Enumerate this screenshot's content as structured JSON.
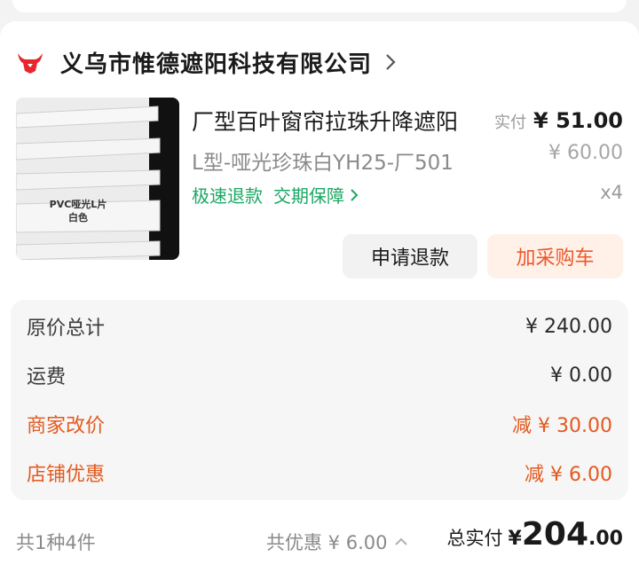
{
  "shop": {
    "name": "义乌市惟德遮阳科技有限公司",
    "logo_icon": "bull-logo-icon",
    "brand_color": "#e8262d"
  },
  "product": {
    "title": "厂型百叶窗帘拉珠升降遮阳",
    "sku": "L型-哑光珍珠白YH25-厂501",
    "tags": [
      "极速退款",
      "交期保障"
    ],
    "image_text": [
      "PVC哑光L片",
      "白色"
    ],
    "paid_label": "实付",
    "paid_price": "¥ 51.00",
    "original_price": "¥ 60.00",
    "quantity": "x4"
  },
  "actions": {
    "refund": "申请退款",
    "add_to_cart": "加采购车"
  },
  "summary": {
    "rows": [
      {
        "label": "原价总计",
        "value": "¥ 240.00"
      },
      {
        "label": "运费",
        "value": "¥ 0.00"
      },
      {
        "label": "商家改价",
        "value": "减 ¥ 30.00"
      },
      {
        "label": "店铺优惠",
        "value": "减 ¥ 6.00"
      }
    ]
  },
  "footer": {
    "count": "共1种4件",
    "discount": "共优惠 ¥ 6.00",
    "total_label": "总实付",
    "total_currency": "¥",
    "total_int": "204",
    "total_dec": ".00"
  },
  "colors": {
    "accent": "#f0562a",
    "green": "#1aa863",
    "discount_red": "#e35a1f"
  }
}
